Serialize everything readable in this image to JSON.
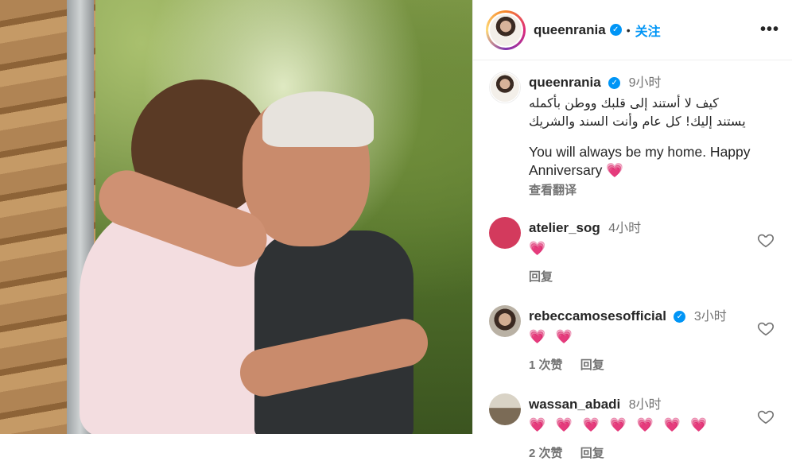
{
  "post": {
    "username": "queenrania",
    "follow_label": "关注",
    "more_label": "•••",
    "caption_time": "9小时",
    "caption_arabic_line1": "كيف لا أستند إلى قلبك ووطن بأكمله",
    "caption_arabic_line2": "يستند إليك! كل عام وأنت السند والشريك",
    "caption_english": "You will always be my home. Happy Anniversary 💗",
    "translate_label": "查看翻译"
  },
  "comments": [
    {
      "username": "atelier_sog",
      "time": "4小时",
      "text": "💗",
      "likes": "",
      "reply_label": "回复",
      "verified": false
    },
    {
      "username": "rebeccamosesofficial",
      "time": "3小时",
      "text": "💗 💗",
      "likes": "1 次赞",
      "reply_label": "回复",
      "verified": true
    },
    {
      "username": "wassan_abadi",
      "time": "8小时",
      "text": "💗 💗 💗 💗 💗 💗 💗",
      "likes": "2 次赞",
      "reply_label": "回复",
      "verified": false
    }
  ],
  "colors": {
    "link": "#0095f6",
    "verified": "#0095f6",
    "muted": "#737373",
    "heart": "#e0245e"
  },
  "icons": {
    "verified": "verified-badge-icon",
    "like": "heart-outline-icon",
    "more": "more-horizontal-icon"
  }
}
